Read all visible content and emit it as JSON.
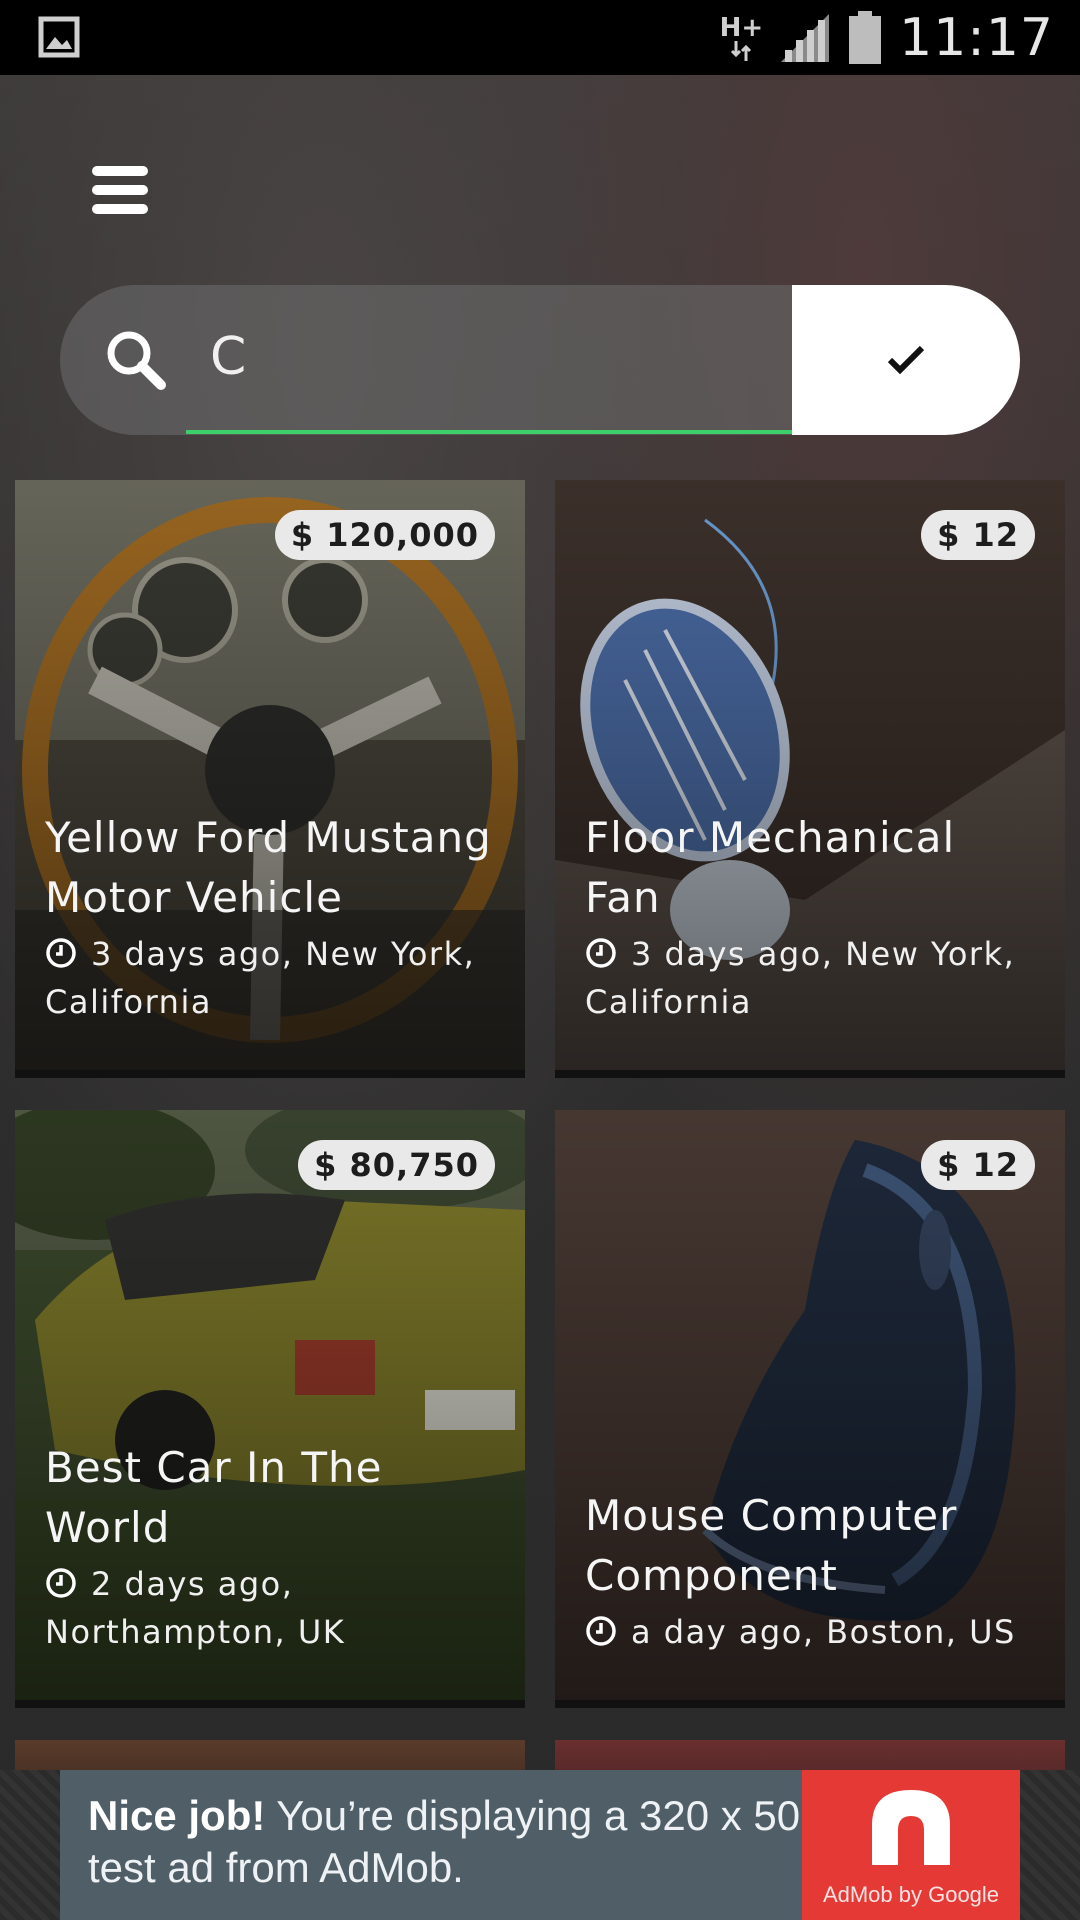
{
  "status_bar": {
    "time": "11:17",
    "network": "H+",
    "icons": [
      "image-notification-icon",
      "network-h-plus-icon",
      "signal-icon",
      "battery-icon"
    ]
  },
  "search": {
    "value": "C",
    "confirm_icon": "check-icon"
  },
  "listings": [
    {
      "price": "$ 120,000",
      "title": "Yellow Ford Mustang Motor Vehicle",
      "meta": "3 days ago, New York, California"
    },
    {
      "price": "$ 12",
      "title": "Floor Mechanical Fan",
      "meta": "3 days ago, New York, California"
    },
    {
      "price": "$ 80,750",
      "title": "Best Car In The World",
      "meta": "2 days ago, Northampton, UK"
    },
    {
      "price": "$ 12",
      "title": "Mouse Computer Component",
      "meta": "a day ago, Boston, US"
    }
  ],
  "ad": {
    "headline": "Nice job!",
    "body": " You’re displaying a 320 x 50 test ad from AdMob.",
    "logo_caption": "AdMob by Google"
  },
  "colors": {
    "accent_underline": "#3ccf6a",
    "badge_bg": "#e9e9e9",
    "ad_bg": "#4f5e67",
    "ad_logo_bg": "#e53935"
  }
}
